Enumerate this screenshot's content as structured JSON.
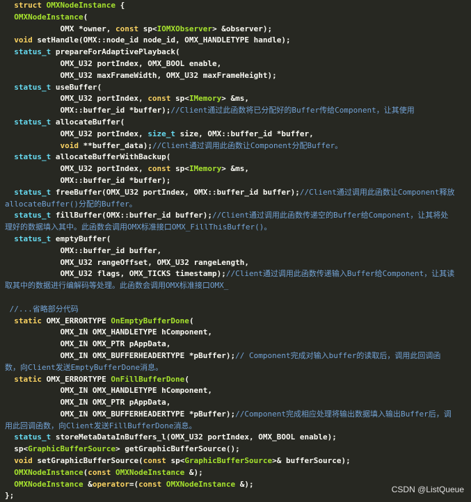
{
  "palette": {
    "background": "#272822",
    "plain": "#F8F8F2",
    "keyword": "#F9D262",
    "type": "#66D9EF",
    "class": "#A6E22E",
    "comment": "#73A3D6"
  },
  "lines": [
    [
      {
        "t": "  "
      },
      {
        "t": "struct",
        "c": "kw"
      },
      {
        "t": " "
      },
      {
        "t": "OMXNodeInstance",
        "c": "cls"
      },
      {
        "t": " {"
      }
    ],
    [
      {
        "t": "  "
      },
      {
        "t": "OMXNodeInstance",
        "c": "cls"
      },
      {
        "t": "("
      }
    ],
    [
      {
        "t": "            OMX *owner, "
      },
      {
        "t": "const",
        "c": "kw"
      },
      {
        "t": " sp<"
      },
      {
        "t": "IOMXObserver",
        "c": "cls"
      },
      {
        "t": "> &observer);"
      }
    ],
    [
      {
        "t": "  "
      },
      {
        "t": "void",
        "c": "kw"
      },
      {
        "t": " setHandle(OMX::node_id node_id, OMX_HANDLETYPE handle);"
      }
    ],
    [
      {
        "t": "  "
      },
      {
        "t": "status_t",
        "c": "ty"
      },
      {
        "t": " prepareForAdaptivePlayback("
      }
    ],
    [
      {
        "t": "            OMX_U32 portIndex, OMX_BOOL enable,"
      }
    ],
    [
      {
        "t": "            OMX_U32 maxFrameWidth, OMX_U32 maxFrameHeight);"
      }
    ],
    [
      {
        "t": "  "
      },
      {
        "t": "status_t",
        "c": "ty"
      },
      {
        "t": " useBuffer("
      }
    ],
    [
      {
        "t": "            OMX_U32 portIndex, "
      },
      {
        "t": "const",
        "c": "kw"
      },
      {
        "t": " sp<"
      },
      {
        "t": "IMemory",
        "c": "cls"
      },
      {
        "t": "> "
      },
      {
        "t": "&",
        "c": "mk"
      },
      {
        "t": "ms,"
      }
    ],
    [
      {
        "t": "            OMX::buffer_id *buffer);"
      },
      {
        "t": "//Client通过此函数将已分配好的Buffer传给Component，让其使用",
        "c": "cm"
      }
    ],
    [
      {
        "t": "  "
      },
      {
        "t": "status_t",
        "c": "ty"
      },
      {
        "t": " allocateBuffer("
      }
    ],
    [
      {
        "t": "            OMX_U32 portIndex, "
      },
      {
        "t": "size_t",
        "c": "ty"
      },
      {
        "t": " size, OMX::buffer_id *buffer,"
      }
    ],
    [
      {
        "t": "            "
      },
      {
        "t": "void",
        "c": "kw"
      },
      {
        "t": " **buffer_data);"
      },
      {
        "t": "//Client通过调用此函数让Component分配Buffer。",
        "c": "cm"
      }
    ],
    [
      {
        "t": "  "
      },
      {
        "t": "status_t",
        "c": "ty"
      },
      {
        "t": " allocateBufferWithBackup("
      }
    ],
    [
      {
        "t": "            OMX_U32 portIndex, "
      },
      {
        "t": "const",
        "c": "kw"
      },
      {
        "t": " sp<"
      },
      {
        "t": "IMemory",
        "c": "cls"
      },
      {
        "t": "> "
      },
      {
        "t": "&",
        "c": "mk"
      },
      {
        "t": "ms,"
      }
    ],
    [
      {
        "t": "            OMX::buffer_id *buffer);"
      }
    ],
    [
      {
        "t": "  "
      },
      {
        "t": "status_t",
        "c": "ty"
      },
      {
        "t": " freeBuffer(OMX_U32 portIndex, OMX::buffer_id buffer);"
      },
      {
        "t": "//Client通过调用此函数让Component释放",
        "c": "cm"
      }
    ],
    [
      {
        "t": "allocateBuffer()分配的Buffer。",
        "c": "cm"
      }
    ],
    [
      {
        "t": "  "
      },
      {
        "t": "status_t",
        "c": "ty"
      },
      {
        "t": " fillBuffer(OMX::buffer_id buffer);"
      },
      {
        "t": "//Client通过调用此函数传递空的Buffer给Component，让其将处",
        "c": "cm"
      }
    ],
    [
      {
        "t": "理好的数据填入其中。此函数会调用OMX标准接口OMX_FillThisBuffer()。",
        "c": "cm"
      }
    ],
    [
      {
        "t": "  "
      },
      {
        "t": "status_t",
        "c": "ty"
      },
      {
        "t": " emptyBuffer("
      }
    ],
    [
      {
        "t": "            OMX::buffer_id buffer,"
      }
    ],
    [
      {
        "t": "            OMX_U32 rangeOffset, OMX_U32 rangeLength,"
      }
    ],
    [
      {
        "t": "            OMX_U32 flags, OMX_TICKS timestamp);"
      },
      {
        "t": "//Client通过调用此函数传递输入Buffer给Component，让其读",
        "c": "cm"
      }
    ],
    [
      {
        "t": "取其中的数据进行编解码等处理。此函数会调用OMX标准接口OMX_",
        "c": "cm"
      }
    ],
    [
      {
        "t": ""
      }
    ],
    [
      {
        "t": " "
      },
      {
        "t": "//...省略部分代码",
        "c": "cm"
      }
    ],
    [
      {
        "t": "  "
      },
      {
        "t": "static",
        "c": "kw"
      },
      {
        "t": " OMX_ERRORTYPE "
      },
      {
        "t": "OnEmptyBufferDone",
        "c": "cls"
      },
      {
        "t": "("
      }
    ],
    [
      {
        "t": "            OMX_IN OMX_HANDLETYPE hComponent,"
      }
    ],
    [
      {
        "t": "            OMX_IN OMX_PTR pAppData,"
      }
    ],
    [
      {
        "t": "            OMX_IN OMX_BUFFERHEADERTYPE *pBuffer);"
      },
      {
        "t": "// Component完成对输入buffer的读取后，调用此回调函",
        "c": "cm"
      }
    ],
    [
      {
        "t": "数，向Client发送EmptyBufferDone消息。",
        "c": "cm"
      }
    ],
    [
      {
        "t": "  "
      },
      {
        "t": "static",
        "c": "kw"
      },
      {
        "t": " OMX_ERRORTYPE "
      },
      {
        "t": "OnFillBufferDone",
        "c": "cls"
      },
      {
        "t": "("
      }
    ],
    [
      {
        "t": "            OMX_IN OMX_HANDLETYPE hComponent,"
      }
    ],
    [
      {
        "t": "            OMX_IN OMX_PTR pAppData,"
      }
    ],
    [
      {
        "t": "            OMX_IN OMX_BUFFERHEADERTYPE *pBuffer);"
      },
      {
        "t": "//Component完成相应处理将输出数据填入输出Buffer后，调",
        "c": "cm"
      }
    ],
    [
      {
        "t": "用此回调函数，向Client发送FillBufferDone消息。",
        "c": "cm"
      }
    ],
    [
      {
        "t": "  "
      },
      {
        "t": "status_t",
        "c": "ty"
      },
      {
        "t": " storeMetaDataInBuffers_l(OMX_U32 portIndex, OMX_BOOL enable);"
      }
    ],
    [
      {
        "t": "  sp<"
      },
      {
        "t": "GraphicBufferSource",
        "c": "cls"
      },
      {
        "t": "> getGraphicBufferSource();"
      }
    ],
    [
      {
        "t": "  "
      },
      {
        "t": "void",
        "c": "kw"
      },
      {
        "t": " setGraphicBufferSource("
      },
      {
        "t": "const",
        "c": "kw"
      },
      {
        "t": " sp<"
      },
      {
        "t": "GraphicBufferSource",
        "c": "cls"
      },
      {
        "t": ">& bufferSource);"
      }
    ],
    [
      {
        "t": "  "
      },
      {
        "t": "OMXNodeInstance",
        "c": "cls"
      },
      {
        "t": "("
      },
      {
        "t": "const",
        "c": "kw"
      },
      {
        "t": " "
      },
      {
        "t": "OMXNodeInstance",
        "c": "cls"
      },
      {
        "t": " &);"
      }
    ],
    [
      {
        "t": "  "
      },
      {
        "t": "OMXNodeInstance",
        "c": "cls"
      },
      {
        "t": " &"
      },
      {
        "t": "operator",
        "c": "kw"
      },
      {
        "t": "=("
      },
      {
        "t": "const",
        "c": "kw"
      },
      {
        "t": " "
      },
      {
        "t": "OMXNodeInstance",
        "c": "cls"
      },
      {
        "t": " &);"
      }
    ],
    [
      {
        "t": "};"
      }
    ]
  ],
  "watermark": "CSDN @ListQueue"
}
